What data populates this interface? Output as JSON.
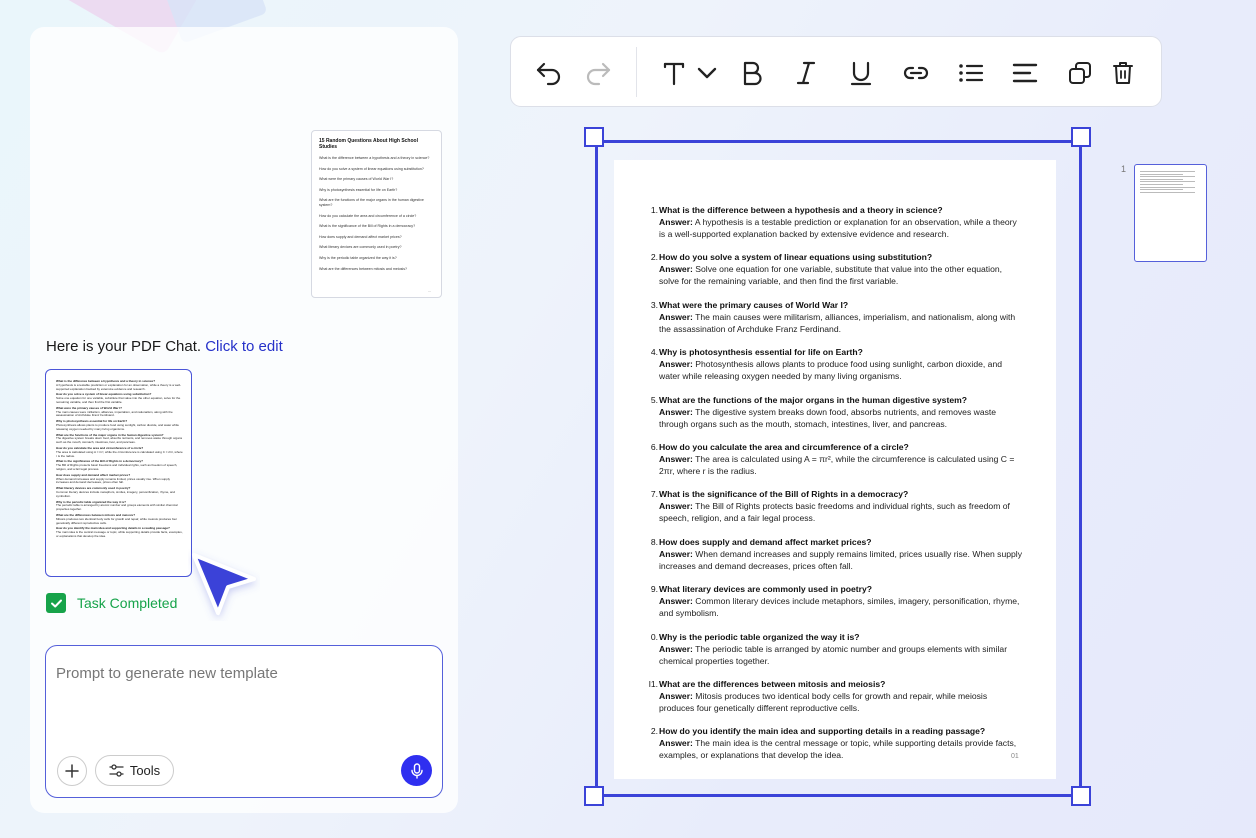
{
  "left_panel": {
    "preview": {
      "title": "15 Random Questions About High School Studies",
      "questions": [
        "What is the difference between a hypothesis and a theory in science?",
        "How do you solve a system of linear equations using substitution?",
        "What were the primary causes of World War I?",
        "Why is photosynthesis essential for life on Earth?",
        "What are the functions of the major organs in the human digestive system?",
        "How do you calculate the area and circumference of a circle?",
        "What is the significance of the Bill of Rights in a democracy?",
        "How does supply and demand affect market prices?",
        "What literary devices are commonly used in poetry?",
        "Why is the periodic table organized the way it is?",
        "What are the differences between mitosis and meiosis?"
      ]
    },
    "chat_message": "Here is your PDF Chat.",
    "chat_link": "Click to edit",
    "task_status": "Task Completed",
    "prompt_placeholder": "Prompt to generate new template",
    "tools_label": "Tools"
  },
  "toolbar": {
    "icons": [
      "undo-icon",
      "redo-icon",
      "text-style-icon",
      "chevron-down-icon",
      "bold-icon",
      "italic-icon",
      "underline-icon",
      "link-icon",
      "list-icon",
      "align-icon",
      "duplicate-icon",
      "delete-icon"
    ]
  },
  "document": {
    "items": [
      {
        "num": "1.",
        "q": "What is the difference between a hypothesis and a theory in science?",
        "a_label": "Answer:",
        "a": "A hypothesis is a testable prediction or explanation for an observation, while a theory is a well-supported explanation backed by extensive evidence and research."
      },
      {
        "num": "2.",
        "q": "How do you solve a system of linear equations using substitution?",
        "a_label": "Answer:",
        "a": "Solve one equation for one variable, substitute that value into the other equation, solve for the remaining variable, and then find the first variable."
      },
      {
        "num": "3.",
        "q": "What were the primary causes of World War I?",
        "a_label": "Answer:",
        "a": "The main causes were militarism, alliances, imperialism, and nationalism, along with the assassination of Archduke Franz Ferdinand."
      },
      {
        "num": "4.",
        "q": "Why is photosynthesis essential for life on Earth?",
        "a_label": "Answer:",
        "a": "Photosynthesis allows plants to produce food using sunlight, carbon dioxide, and water while releasing oxygen needed by many living organisms."
      },
      {
        "num": "5.",
        "q": "What are the functions of the major organs in the human digestive system?",
        "a_label": "Answer:",
        "a": "The digestive system breaks down food, absorbs nutrients, and removes waste through organs such as the mouth, stomach, intestines, liver, and pancreas."
      },
      {
        "num": "6.",
        "q": "How do you calculate the area and circumference of a circle?",
        "a_label": "Answer:",
        "a": "The area is calculated using A = πr², while the circumference is calculated using C = 2πr, where r is the radius."
      },
      {
        "num": "7.",
        "q": "What is the significance of the Bill of Rights in a democracy?",
        "a_label": "Answer:",
        "a": "The Bill of Rights protects basic freedoms and individual rights, such as freedom of speech, religion, and a fair legal process."
      },
      {
        "num": "8.",
        "q": "How does supply and demand affect market prices?",
        "a_label": "Answer:",
        "a": "When demand increases and supply remains limited, prices usually rise. When supply increases and demand decreases, prices often fall."
      },
      {
        "num": "9.",
        "q": "What literary devices are commonly used in poetry?",
        "a_label": "Answer:",
        "a": "Common literary devices include metaphors, similes, imagery, personification, rhyme, and symbolism."
      },
      {
        "num": "0.",
        "q": "Why is the periodic table organized the way it is?",
        "a_label": "Answer:",
        "a": "The periodic table is arranged by atomic number and groups elements with similar chemical properties together."
      },
      {
        "num": "l1.",
        "q": "What are the differences between mitosis and meiosis?",
        "a_label": "Answer:",
        "a": "Mitosis produces two identical body cells for growth and repair, while meiosis produces four genetically different reproductive cells."
      },
      {
        "num": "2.",
        "q": "How do you identify the main idea and supporting details in a reading passage?",
        "a_label": "Answer:",
        "a": "The main idea is the central message or topic, while supporting details provide facts, examples, or explanations that develop the idea."
      }
    ],
    "page_number": "01"
  },
  "thumbnails": {
    "page_label": "1"
  }
}
